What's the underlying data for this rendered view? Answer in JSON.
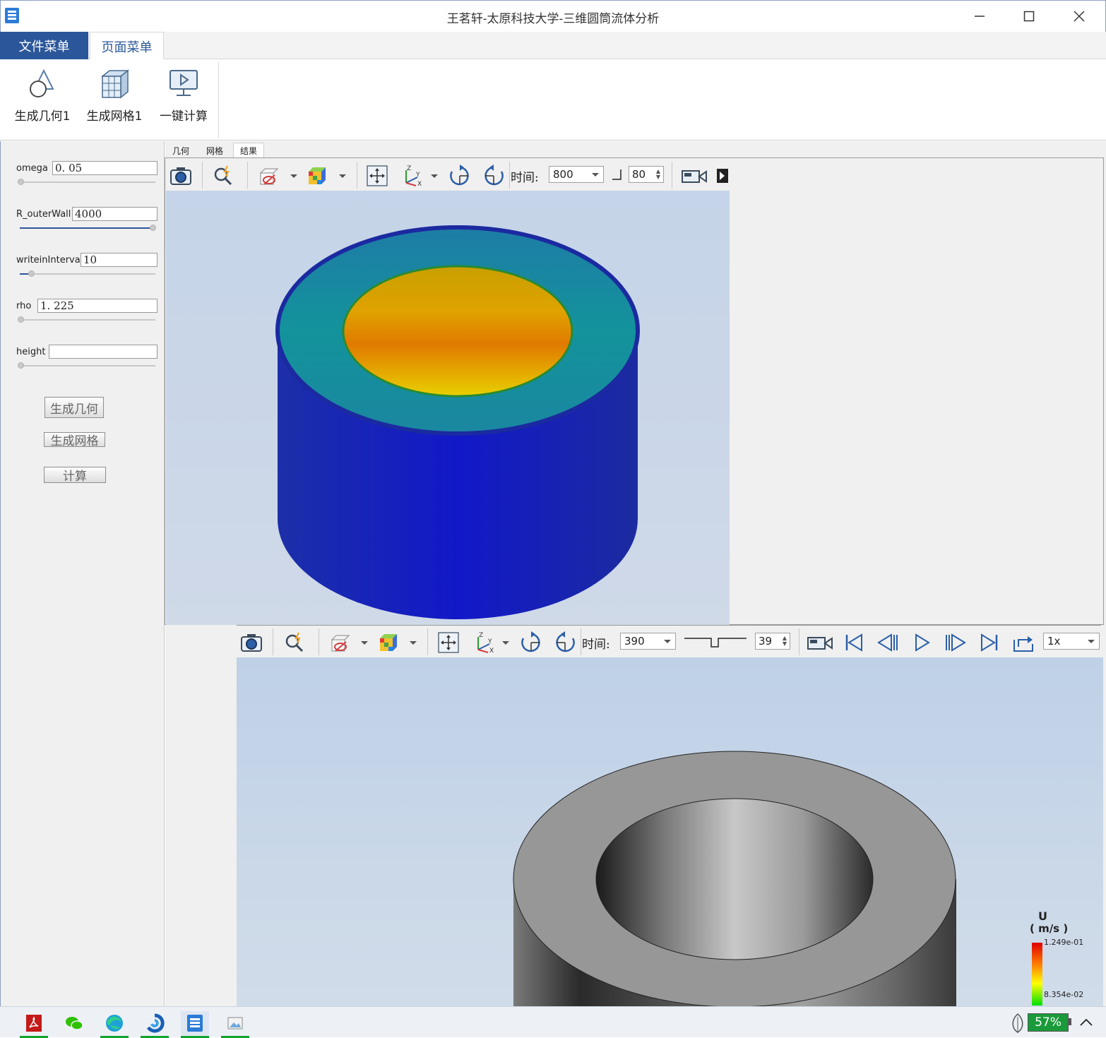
{
  "window": {
    "title": "王茗轩-太原科技大学-三维圆筒流体分析"
  },
  "ribbon_tabs": [
    {
      "label": "文件菜单",
      "active": false
    },
    {
      "label": "页面菜单",
      "active": true
    }
  ],
  "ribbon_buttons": [
    {
      "label": "生成几何1",
      "icon": "geometry-icon"
    },
    {
      "label": "生成网格1",
      "icon": "mesh-cube-icon"
    },
    {
      "label": "一键计算",
      "icon": "compute-play-icon"
    }
  ],
  "params": [
    {
      "label": "omega",
      "value": "0. 05",
      "level": 0.0
    },
    {
      "label": "R_outerWall",
      "value": "4000",
      "level": 1.0
    },
    {
      "label": "writeinInterval",
      "value": "10",
      "level": 0.08
    },
    {
      "label": "rho",
      "value": "1. 225",
      "level": 0.0
    },
    {
      "label": "height",
      "value": "",
      "level": 0.0
    }
  ],
  "actions": {
    "gen_geometry": "生成几何",
    "gen_mesh": "生成网格",
    "compute": "计算"
  },
  "view_tabs": [
    {
      "label": "几何"
    },
    {
      "label": "网格"
    },
    {
      "label": "结果",
      "active": true
    }
  ],
  "view1": {
    "time_label": "时间:",
    "time_value": "800",
    "frame_value": "80"
  },
  "view2": {
    "time_label": "时间:",
    "time_value": "390",
    "frame_value": "39",
    "speed": "1x"
  },
  "legend": {
    "variable": "U",
    "unit": "( m/s )",
    "max": "1.249e-01",
    "min": "8.354e-02",
    "colors": [
      "#e00000",
      "#ffff00",
      "#00e000"
    ]
  },
  "taskbar": {
    "battery": "57%",
    "apps": [
      "pdf-reader-icon",
      "wechat-icon",
      "edge-browser-icon",
      "app-swirl-icon",
      "cfd-app-icon",
      "photo-viewer-icon"
    ]
  }
}
